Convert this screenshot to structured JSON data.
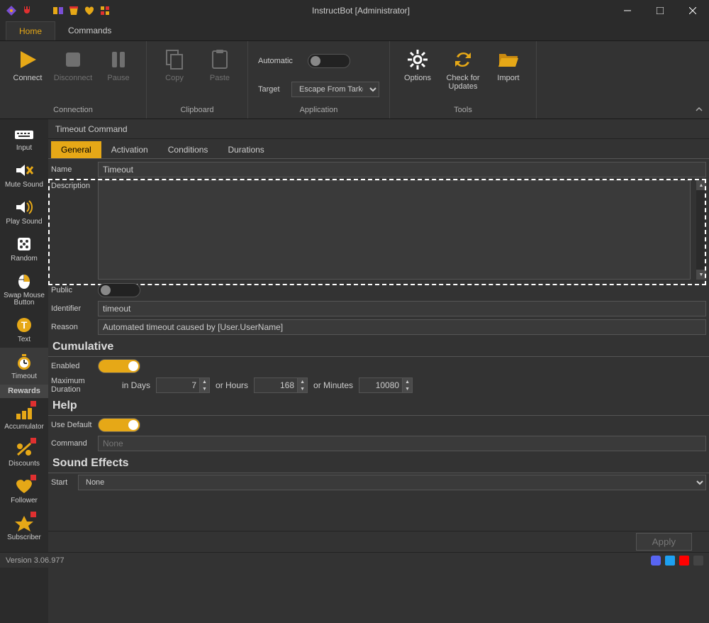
{
  "window": {
    "title": "InstructBot [Administrator]"
  },
  "menu": {
    "tabs": [
      "Home",
      "Commands"
    ],
    "active": "Home"
  },
  "ribbon": {
    "groups": {
      "connection": {
        "label": "Connection",
        "connect": "Connect",
        "disconnect": "Disconnect",
        "pause": "Pause"
      },
      "clipboard": {
        "label": "Clipboard",
        "copy": "Copy",
        "paste": "Paste"
      },
      "application": {
        "label": "Application",
        "automatic_label": "Automatic",
        "automatic_on": false,
        "target_label": "Target",
        "target_value": "Escape From Tarkov"
      },
      "tools": {
        "label": "Tools",
        "options": "Options",
        "check": "Check for Updates",
        "import": "Import"
      }
    }
  },
  "sidebar": {
    "items": [
      {
        "key": "input",
        "label": "Input"
      },
      {
        "key": "mute",
        "label": "Mute Sound"
      },
      {
        "key": "play",
        "label": "Play Sound"
      },
      {
        "key": "random",
        "label": "Random"
      },
      {
        "key": "swap",
        "label": "Swap Mouse Button"
      },
      {
        "key": "text",
        "label": "Text"
      },
      {
        "key": "timeout",
        "label": "Timeout"
      }
    ],
    "header": "Rewards",
    "rewards": [
      {
        "key": "accum",
        "label": "Accumulator"
      },
      {
        "key": "disc",
        "label": "Discounts"
      },
      {
        "key": "foll",
        "label": "Follower"
      },
      {
        "key": "sub",
        "label": "Subscriber"
      }
    ],
    "active": "timeout"
  },
  "page": {
    "crumb": "Timeout Command",
    "subtabs": [
      "General",
      "Activation",
      "Conditions",
      "Durations"
    ],
    "active_subtab": "General",
    "fields": {
      "name_label": "Name",
      "name_value": "Timeout",
      "description_label": "Description",
      "description_value": "",
      "public_label": "Public",
      "public_on": false,
      "identifier_label": "Identifier",
      "identifier_value": "timeout",
      "reason_label": "Reason",
      "reason_value": "Automated timeout caused by [User.UserName]"
    },
    "cumulative": {
      "title": "Cumulative",
      "enabled_label": "Enabled",
      "enabled_on": true,
      "maxdur_label": "Maximum Duration",
      "days_label": "in Days",
      "days": "7",
      "hours_label": "or Hours",
      "hours": "168",
      "minutes_label": "or Minutes",
      "minutes": "10080"
    },
    "help": {
      "title": "Help",
      "usedefault_label": "Use Default",
      "usedefault_on": true,
      "command_label": "Command",
      "command_value": "None"
    },
    "sound": {
      "title": "Sound Effects",
      "start_label": "Start",
      "start_value": "None"
    }
  },
  "applybar": {
    "apply": "Apply"
  },
  "footer": {
    "version": "Version 3.06.977"
  }
}
